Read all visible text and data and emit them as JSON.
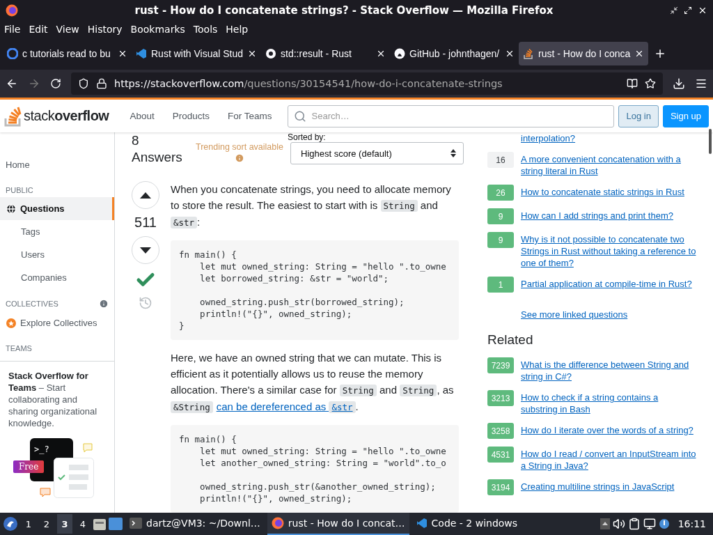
{
  "window": {
    "title": "rust - How do I concatenate strings? - Stack Overflow — Mozilla Firefox"
  },
  "menu": [
    "File",
    "Edit",
    "View",
    "History",
    "Bookmarks",
    "Tools",
    "Help"
  ],
  "tabs": [
    {
      "label": "c tutorials read to bu",
      "selected": false
    },
    {
      "label": "Rust with Visual Stud",
      "selected": false
    },
    {
      "label": "std::result - Rust",
      "selected": false
    },
    {
      "label": "GitHub - johnthagen/",
      "selected": false
    },
    {
      "label": "rust - How do I conca",
      "selected": true
    }
  ],
  "address": {
    "host": "https://stackoverflow.com",
    "path": "/questions/30154541/how-do-i-concatenate-strings"
  },
  "site_header": {
    "logo": "stack**overflow**",
    "nav": [
      "About",
      "Products",
      "For Teams"
    ],
    "search": {
      "placeholder": "Search…"
    },
    "buttons": [
      {
        "label": "Log in",
        "kind": "secondary"
      },
      {
        "label": "Sign up",
        "kind": "primary"
      }
    ]
  },
  "sidebar": {
    "items": [
      {
        "kind": "link",
        "label": "Home",
        "selected": false
      },
      {
        "kind": "heading",
        "label": "PUBLIC"
      },
      {
        "kind": "link",
        "label": "Questions",
        "selected": true
      },
      {
        "kind": "sub",
        "label": "Tags",
        "selected": false
      },
      {
        "kind": "sub",
        "label": "Users",
        "selected": false
      },
      {
        "kind": "sub",
        "label": "Companies",
        "selected": false
      },
      {
        "kind": "heading",
        "label": "COLLECTIVES",
        "info": true
      },
      {
        "kind": "link",
        "label": "Explore Collectives",
        "selected": false
      },
      {
        "kind": "heading",
        "label": "TEAMS"
      }
    ],
    "teams": {
      "text": "**Stack Overflow for Teams** – Start collaborating and sharing organizational knowledge.",
      "prompt": ">_?",
      "badge": "Free"
    }
  },
  "answers": {
    "count": "8 Answers",
    "trending": "Trending sort available",
    "sorted_by": "Sorted by:",
    "sort": "Highest score (default)"
  },
  "answer": {
    "score": "511",
    "accepted": true,
    "body": [
      {
        "kind": "paragraph",
        "segments": [
          {
            "kind": "text",
            "text": "When you concatenate strings, you need to allocate memory to store the result. The easiest to start with is "
          },
          {
            "kind": "code",
            "text": "String"
          },
          {
            "kind": "text",
            "text": " and "
          },
          {
            "kind": "code",
            "text": "&str"
          },
          {
            "kind": "text",
            "text": ":"
          }
        ]
      },
      {
        "kind": "code",
        "groups": [
          [
            "fn main() {",
            "    let mut owned_string: String = \"hello \".to_owne",
            "    let borrowed_string: &str = \"world\";"
          ],
          [
            "    owned_string.push_str(borrowed_string);",
            "    println!(\"{}\", owned_string);",
            "}"
          ]
        ]
      },
      {
        "kind": "paragraph",
        "segments": [
          {
            "kind": "text",
            "text": "Here, we have an owned string that we can mutate. This is efficient as it potentially allows us to reuse the memory allocation. There's a similar case for "
          },
          {
            "kind": "code",
            "text": "String"
          },
          {
            "kind": "text",
            "text": " and "
          },
          {
            "kind": "code",
            "text": "String"
          },
          {
            "kind": "text",
            "text": ", as "
          },
          {
            "kind": "code",
            "text": "&String"
          },
          {
            "kind": "link",
            "text": "can be dereferenced as ",
            "code": "&str"
          },
          {
            "kind": "text",
            "text": "."
          }
        ]
      },
      {
        "kind": "code",
        "groups": [
          [
            "fn main() {",
            "    let mut owned_string: String = \"hello \".to_owne",
            "    let another_owned_string: String = \"world\".to_o"
          ],
          [
            "    owned_string.push_str(&another_owned_string);",
            "    println!(\"{}\", owned_string);"
          ]
        ]
      }
    ]
  },
  "linked": {
    "items": [
      {
        "kind": "clipped",
        "title": "interpolation?"
      },
      {
        "kind": "question",
        "count": "16",
        "answered": false,
        "title": "A more convenient concatenation with a string literal in Rust"
      },
      {
        "kind": "question",
        "count": "26",
        "answered": true,
        "title": "How to concatenate static strings in Rust"
      },
      {
        "kind": "question",
        "count": "9",
        "answered": true,
        "title": "How can I add strings and print them?"
      },
      {
        "kind": "question",
        "count": "9",
        "answered": true,
        "title": "Why is it not possible to concatenate two Strings in Rust without taking a reference to one of them?"
      },
      {
        "kind": "question",
        "count": "1",
        "answered": true,
        "title": "Partial application at compile-time in Rust?"
      }
    ],
    "more": "See more linked questions"
  },
  "related": {
    "title": "Related",
    "items": [
      {
        "count": "7239",
        "answered": true,
        "title": "What is the difference between String and string in C#?"
      },
      {
        "count": "3213",
        "answered": true,
        "title": "How to check if a string contains a substring in Bash"
      },
      {
        "count": "3258",
        "answered": true,
        "title": "How do I iterate over the words of a string?"
      },
      {
        "count": "4531",
        "answered": true,
        "title": "How do I read / convert an InputStream into a String in Java?"
      },
      {
        "count": "3194",
        "answered": true,
        "title": "Creating multiline strings in JavaScript"
      }
    ]
  },
  "taskbar": {
    "workspaces": [
      {
        "label": "1",
        "selected": false
      },
      {
        "label": "2",
        "selected": false
      },
      {
        "label": "3",
        "selected": true
      },
      {
        "label": "4",
        "selected": false
      }
    ],
    "tasks": [
      {
        "label": "dartz@VM3: ~/Downl…",
        "selected": false
      },
      {
        "label": "rust - How do I concat…",
        "selected": true
      },
      {
        "label": "Code - 2 windows",
        "selected": false
      }
    ],
    "clock": "16:11"
  }
}
